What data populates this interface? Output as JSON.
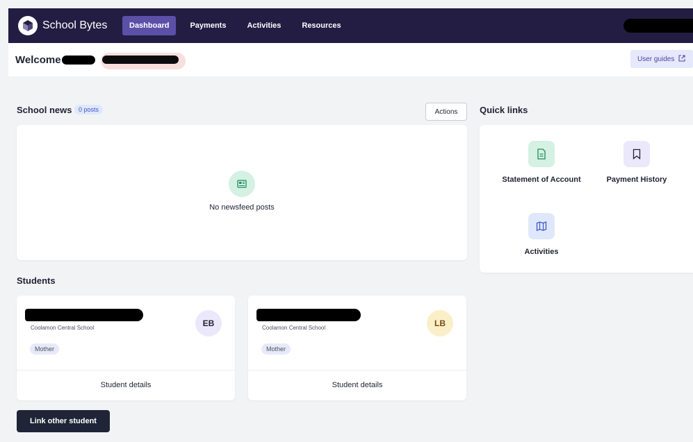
{
  "nav": {
    "brand": "School Bytes",
    "items": [
      {
        "label": "Dashboard",
        "active": true
      },
      {
        "label": "Payments",
        "active": false
      },
      {
        "label": "Activities",
        "active": false
      },
      {
        "label": "Resources",
        "active": false
      }
    ]
  },
  "welcome": {
    "text": "Welcome",
    "user_guides_label": "User guides"
  },
  "school_news": {
    "title": "School news",
    "badge": "0 posts",
    "actions_label": "Actions",
    "empty_text": "No newsfeed posts"
  },
  "quick_links": {
    "title": "Quick links",
    "items": [
      {
        "label": "Statement of Account",
        "icon": "document-icon"
      },
      {
        "label": "Payment History",
        "icon": "bookmark-icon"
      },
      {
        "label": "Activities",
        "icon": "map-icon"
      }
    ]
  },
  "students": {
    "title": "Students",
    "cards": [
      {
        "school": "Coolamon Central School",
        "role": "Mother",
        "initials": "EB",
        "details_label": "Student details",
        "avatar_color": "#ece8fb"
      },
      {
        "school": "Coolamon Central School",
        "role": "Mother",
        "initials": "LB",
        "details_label": "Student details",
        "avatar_color": "#fbefc8"
      }
    ],
    "link_label": "Link other student"
  },
  "colors": {
    "nav_bg": "#231d43",
    "nav_active": "#5a50a8",
    "accent": "#4a3fa8"
  }
}
